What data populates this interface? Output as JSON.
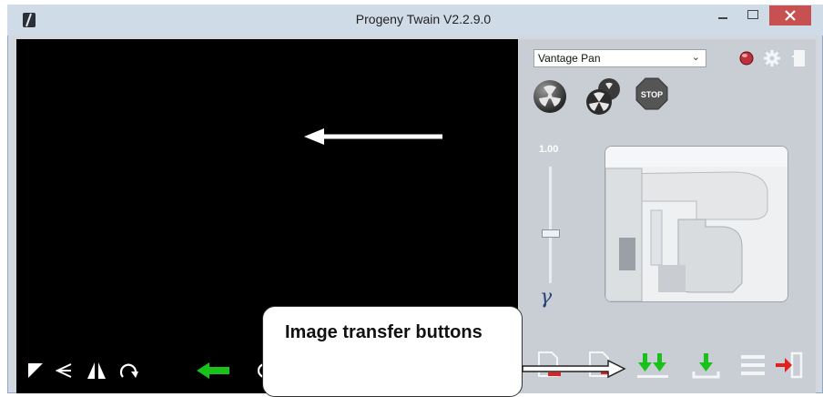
{
  "window": {
    "title": "Progeny Twain V2.2.9.0"
  },
  "device": {
    "selected": "Vantage Pan"
  },
  "gamma": {
    "value": "1.00",
    "symbol": "γ"
  },
  "callout": {
    "text": "Image transfer buttons"
  },
  "status_led_color": "#c0303a",
  "accent_green": "#18c21a",
  "accent_red": "#e32020",
  "icons": [
    "app-icon",
    "status-led-icon",
    "gear-icon",
    "exit-panel-icon",
    "expose-icon",
    "expose-multi-icon",
    "stop-icon",
    "contrast-icon",
    "flip-vertical-icon",
    "flip-horizontal-icon",
    "rotate-icon",
    "back-arrow-icon",
    "remove-image-icon",
    "remove-all-icon",
    "transfer-all-icon",
    "transfer-selected-icon",
    "menu-icon",
    "exit-icon"
  ]
}
